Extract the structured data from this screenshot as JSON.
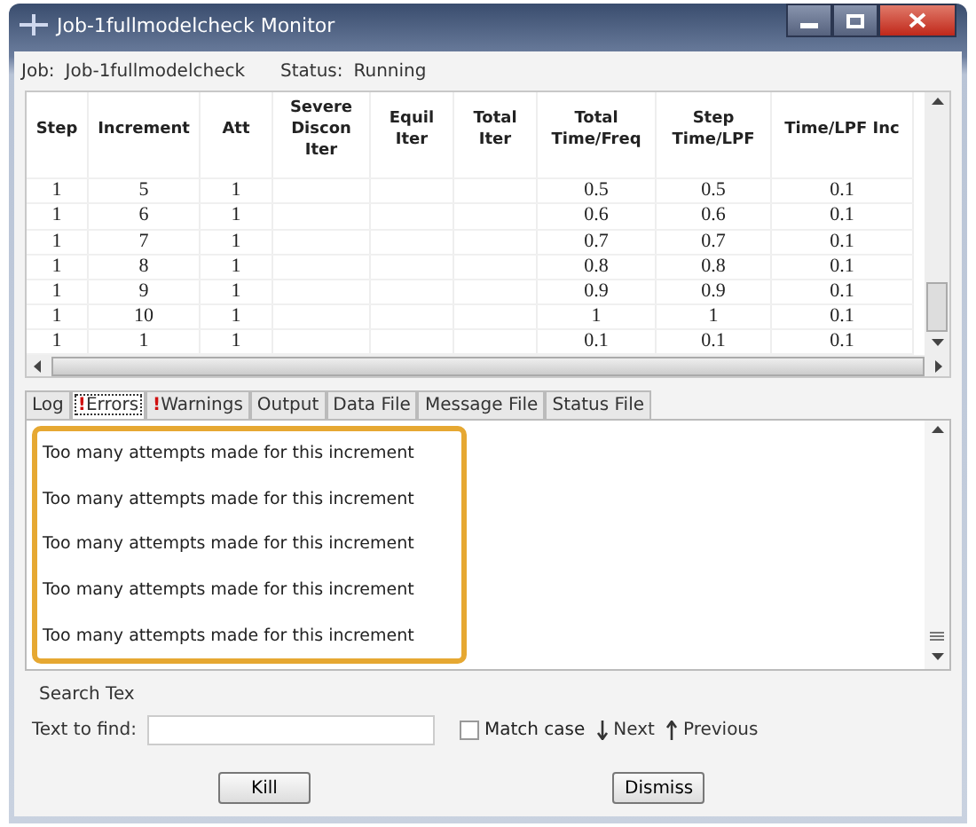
{
  "window": {
    "title": "Job-1fullmodelcheck Monitor"
  },
  "job": {
    "label": "Job:",
    "value": "Job-1fullmodelcheck",
    "status_label": "Status:",
    "status": "Running"
  },
  "table": {
    "columns": [
      "Step",
      "Increment",
      "Att",
      "Severe Discon Iter",
      "Equil Iter",
      "Total Iter",
      "Total Time/Freq",
      "Step Time/LPF",
      "Time/LPF Inc"
    ],
    "rows": [
      [
        "1",
        "5",
        "1",
        "",
        "",
        "",
        "0.5",
        "0.5",
        "0.1"
      ],
      [
        "1",
        "6",
        "1",
        "",
        "",
        "",
        "0.6",
        "0.6",
        "0.1"
      ],
      [
        "1",
        "7",
        "1",
        "",
        "",
        "",
        "0.7",
        "0.7",
        "0.1"
      ],
      [
        "1",
        "8",
        "1",
        "",
        "",
        "",
        "0.8",
        "0.8",
        "0.1"
      ],
      [
        "1",
        "9",
        "1",
        "",
        "",
        "",
        "0.9",
        "0.9",
        "0.1"
      ],
      [
        "1",
        "10",
        "1",
        "",
        "",
        "",
        "1",
        "1",
        "0.1"
      ],
      [
        "1",
        "1",
        "1",
        "",
        "",
        "",
        "0.1",
        "0.1",
        "0.1"
      ]
    ]
  },
  "tabs": [
    {
      "label": "Log",
      "selected": false
    },
    {
      "label": "Errors",
      "flag": "!",
      "selected": true
    },
    {
      "label": "Warnings",
      "flag": "!",
      "selected": false
    },
    {
      "label": "Output",
      "selected": false
    },
    {
      "label": "Data File",
      "selected": false
    },
    {
      "label": "Message File",
      "selected": false
    },
    {
      "label": "Status File",
      "selected": false
    }
  ],
  "messages": [
    "Too many attempts made for this increment",
    "Too many attempts made for this increment",
    "Too many attempts made for this increment",
    "Too many attempts made for this increment",
    "Too many attempts made for this increment"
  ],
  "search": {
    "title": "Search Tex",
    "label": "Text to find:",
    "match_case": {
      "label": "Match case",
      "checked": false
    },
    "next": "Next",
    "previous": "Previous"
  },
  "buttons": [
    "Kill",
    "Dismiss"
  ]
}
